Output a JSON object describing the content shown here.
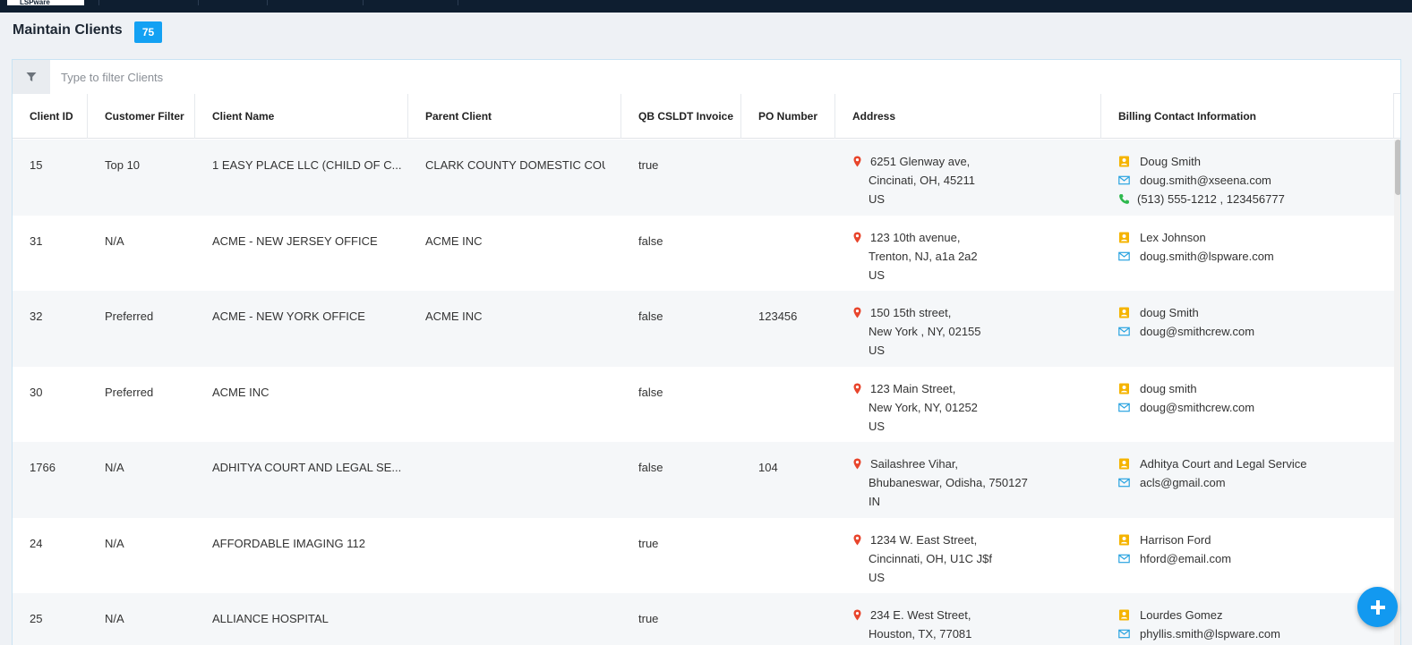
{
  "header": {
    "logo_text": "LSPware"
  },
  "page": {
    "title": "Maintain Clients",
    "count": "75"
  },
  "filter": {
    "placeholder": "Type to filter Clients"
  },
  "columns": [
    "Client ID",
    "Customer Filter",
    "Client Name",
    "Parent Client",
    "QB CSLDT Invoice",
    "PO Number",
    "Address",
    "Billing Contact Information"
  ],
  "rows": [
    {
      "id": "15",
      "filter": "Top 10",
      "name": "1 EASY PLACE LLC (CHILD OF C...",
      "parent": "CLARK COUNTY DOMESTIC COURT",
      "qb": "true",
      "po": "",
      "address": [
        "6251 Glenway ave,",
        "Cincinati, OH, 45211",
        "US"
      ],
      "contact": {
        "name": "Doug Smith",
        "email": "doug.smith@xseena.com",
        "phone": "(513) 555-1212 , 123456777"
      }
    },
    {
      "id": "31",
      "filter": "N/A",
      "name": "ACME - NEW JERSEY OFFICE",
      "parent": "ACME INC",
      "qb": "false",
      "po": "",
      "address": [
        "123 10th avenue,",
        "Trenton, NJ, a1a 2a2",
        "US"
      ],
      "contact": {
        "name": "Lex Johnson",
        "email": "doug.smith@lspware.com"
      }
    },
    {
      "id": "32",
      "filter": "Preferred",
      "name": "ACME - NEW YORK OFFICE",
      "parent": "ACME INC",
      "qb": "false",
      "po": "123456",
      "address": [
        "150 15th street,",
        "New York , NY, 02155",
        "US"
      ],
      "contact": {
        "name": "doug Smith",
        "email": "doug@smithcrew.com"
      }
    },
    {
      "id": "30",
      "filter": "Preferred",
      "name": "ACME INC",
      "parent": "",
      "qb": "false",
      "po": "",
      "address": [
        "123 Main Street,",
        "New York, NY, 01252",
        "US"
      ],
      "contact": {
        "name": "doug smith",
        "email": "doug@smithcrew.com"
      }
    },
    {
      "id": "1766",
      "filter": "N/A",
      "name": "ADHITYA COURT AND LEGAL SE...",
      "parent": "",
      "qb": "false",
      "po": "104",
      "address": [
        "Sailashree Vihar,",
        "Bhubaneswar, Odisha, 750127",
        "IN"
      ],
      "contact": {
        "name": "Adhitya Court and Legal Service",
        "email": "acls@gmail.com"
      }
    },
    {
      "id": "24",
      "filter": "N/A",
      "name": "AFFORDABLE IMAGING 112",
      "parent": "",
      "qb": "true",
      "po": "",
      "address": [
        "1234 W. East Street,",
        "Cincinnati, OH, U1C J$f",
        "US"
      ],
      "contact": {
        "name": "Harrison Ford",
        "email": "hford@email.com"
      }
    },
    {
      "id": "25",
      "filter": "N/A",
      "name": "ALLIANCE HOSPITAL",
      "parent": "",
      "qb": "true",
      "po": "",
      "address": [
        "234 E. West Street,",
        "Houston, TX, 77081",
        ""
      ],
      "contact": {
        "name": "Lourdes Gomez",
        "email": "phyllis.smith@lspware.com"
      }
    }
  ],
  "icons": {
    "filter": "filter-icon",
    "address": "map-marker-icon",
    "contact": "contact-card-icon",
    "email": "envelope-icon",
    "phone": "phone-icon",
    "add": "plus-icon"
  },
  "colors": {
    "accent": "#13a1f3",
    "topbar": "#0e1e30",
    "marker": "#e8452c",
    "contact": "#f5b400",
    "email": "#2aa3e0",
    "phone": "#2db84d"
  }
}
